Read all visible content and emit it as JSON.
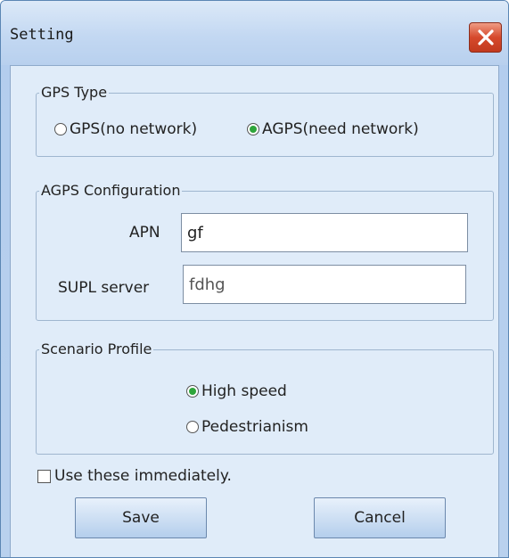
{
  "window": {
    "title": "Setting"
  },
  "gps_type": {
    "legend": "GPS Type",
    "options": [
      {
        "label": "GPS(no network)",
        "checked": false
      },
      {
        "label": "AGPS(need network)",
        "checked": true
      }
    ]
  },
  "agps_config": {
    "legend": "AGPS Configuration",
    "apn": {
      "label": "APN",
      "value": "gf"
    },
    "supl": {
      "label": "SUPL server",
      "value": "fdhg"
    }
  },
  "scenario": {
    "legend": "Scenario Profile",
    "options": [
      {
        "label": "High speed",
        "checked": true
      },
      {
        "label": "Pedestrianism",
        "checked": false
      }
    ]
  },
  "use_immediately": {
    "label": "Use these immediately.",
    "checked": false
  },
  "buttons": {
    "save": "Save",
    "cancel": "Cancel"
  },
  "colors": {
    "accent_radio": "#2ea53b",
    "close_button": "#d6492c"
  },
  "icons": {
    "close": "close-icon"
  }
}
